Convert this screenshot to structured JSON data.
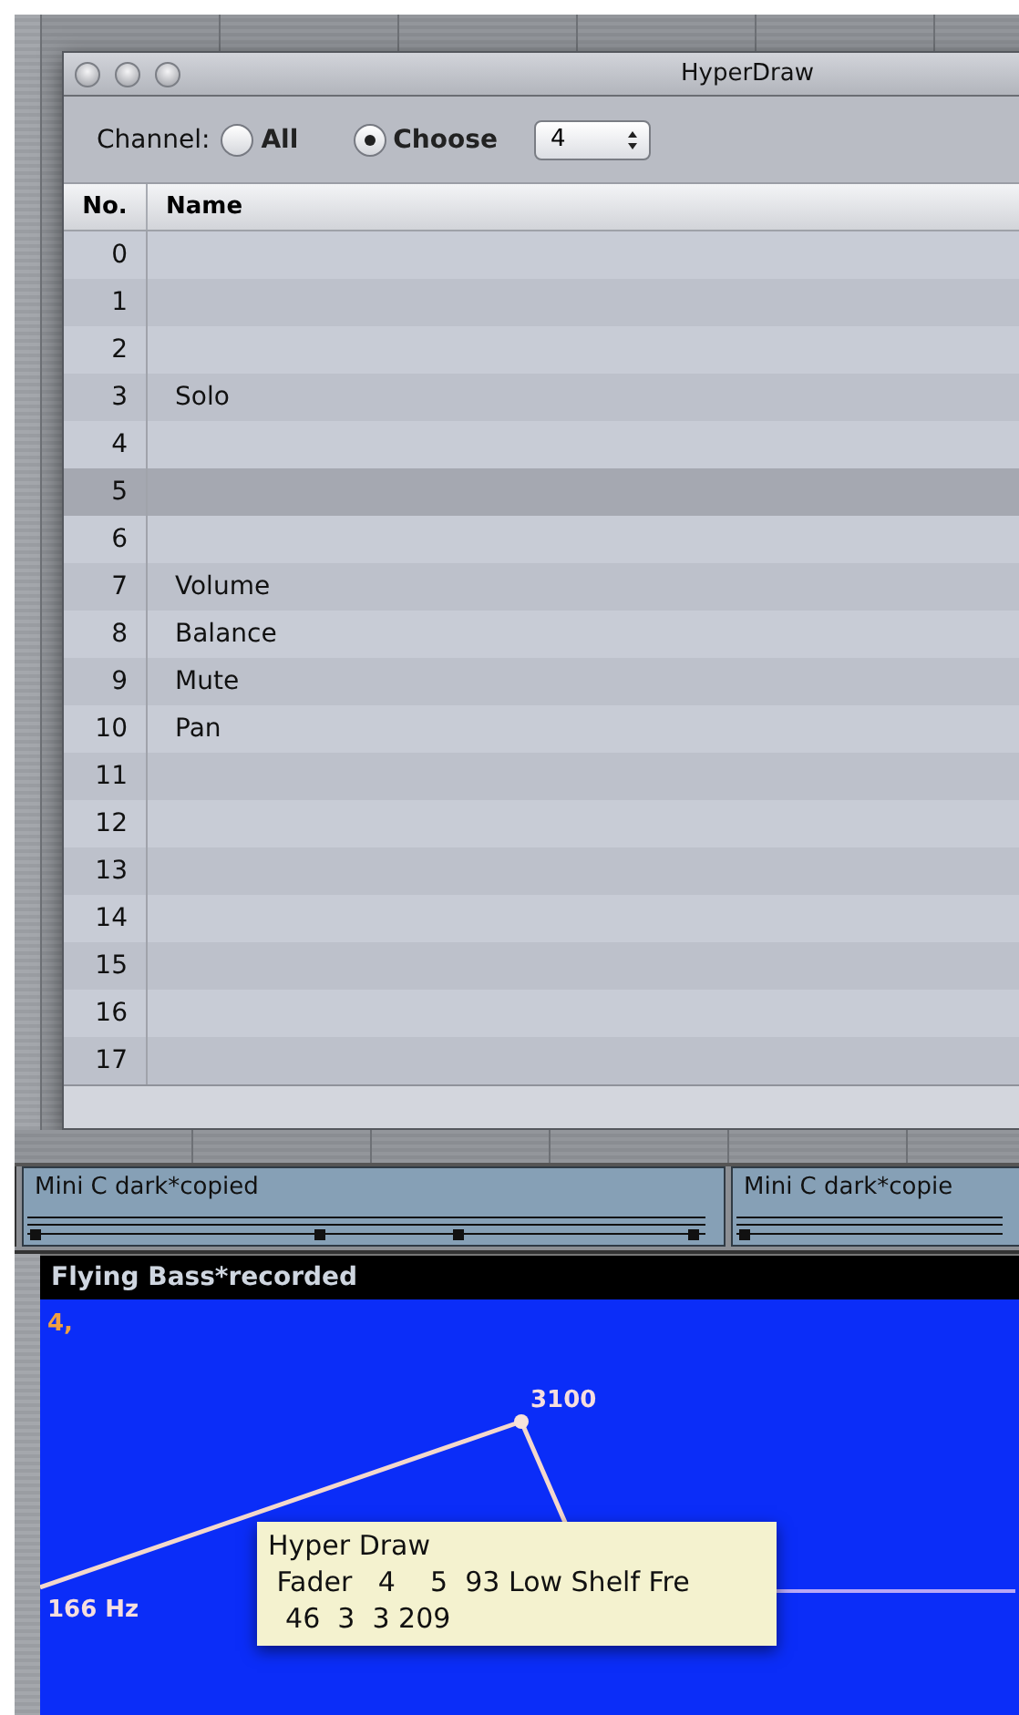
{
  "window": {
    "title": "HyperDraw"
  },
  "channel": {
    "label": "Channel:",
    "options": [
      {
        "label": "All",
        "selected": false
      },
      {
        "label": "Choose",
        "selected": true
      }
    ],
    "stepper": {
      "value": "4"
    }
  },
  "table": {
    "columns": [
      "No.",
      "Name"
    ],
    "rows": [
      {
        "no": "0",
        "selected": false
      },
      {
        "no": "1",
        "selected": false
      },
      {
        "no": "2",
        "selected": false
      },
      {
        "no": "3",
        "name": "Solo",
        "selected": false
      },
      {
        "no": "4",
        "selected": false
      },
      {
        "no": "5",
        "selected": true
      },
      {
        "no": "6",
        "selected": false
      },
      {
        "no": "7",
        "name": "Volume",
        "selected": false
      },
      {
        "no": "8",
        "name": "Balance",
        "selected": false
      },
      {
        "no": "9",
        "name": "Mute",
        "selected": false
      },
      {
        "no": "10",
        "name": "Pan",
        "selected": false
      },
      {
        "no": "11",
        "selected": false
      },
      {
        "no": "12",
        "selected": false
      },
      {
        "no": "13",
        "selected": false
      },
      {
        "no": "14",
        "selected": false
      },
      {
        "no": "15",
        "selected": false
      },
      {
        "no": "16",
        "selected": false
      },
      {
        "no": "17",
        "selected": false
      }
    ]
  },
  "regions": [
    {
      "name": "Mini C dark*copied"
    },
    {
      "name": "Mini C dark*copie"
    }
  ],
  "automation": {
    "title": "Flying Bass*recorded",
    "channel": "4,",
    "point_labels": [
      "3100",
      "166 Hz"
    ],
    "tooltip": {
      "title": "Hyper Draw",
      "lines": [
        " Fader   4    5  93 Low Shelf Fre",
        "  46  3  3 209"
      ]
    }
  }
}
